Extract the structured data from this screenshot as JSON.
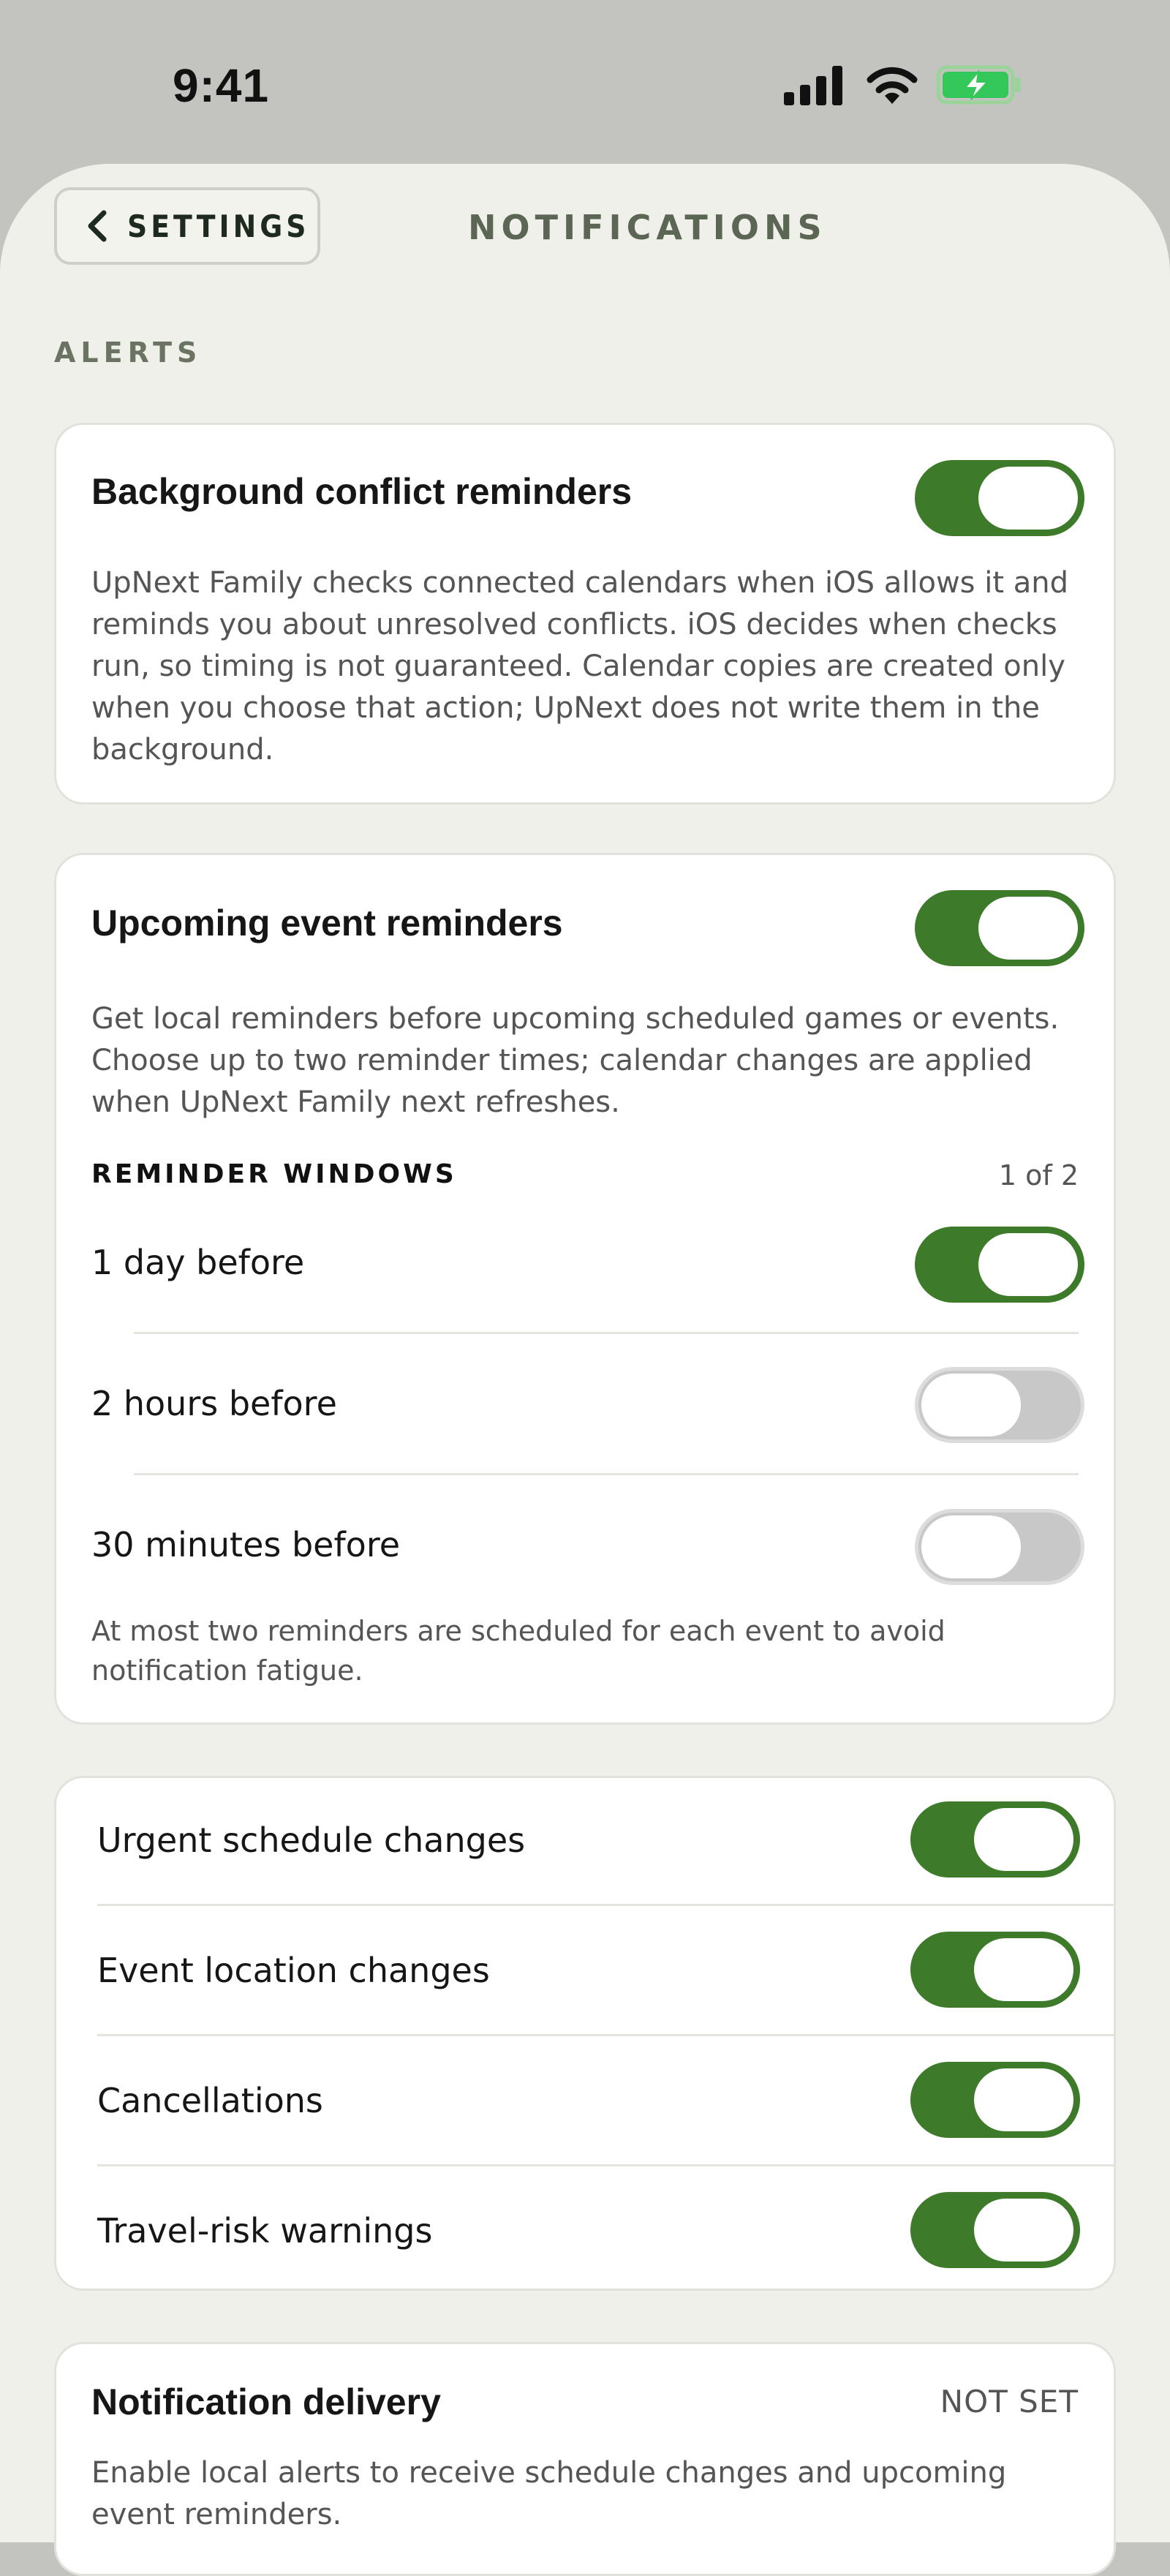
{
  "status_bar": {
    "time": "9:41",
    "icons": [
      "cellular-signal-icon",
      "wifi-icon",
      "battery-charging-icon"
    ],
    "battery_color": "#34c759"
  },
  "nav": {
    "back_label": "SETTINGS",
    "back_icon": "chevron-left-icon",
    "title": "NOTIFICATIONS"
  },
  "section": {
    "label": "ALERTS"
  },
  "background_conflict": {
    "title": "Background conflict reminders",
    "enabled": true,
    "description": "UpNext Family checks connected calendars when iOS allows it and reminds you about unresolved conflicts. iOS decides when checks run, so timing is not guaranteed. Calendar copies are created only when you choose that action; UpNext does not write them in the background."
  },
  "upcoming_events": {
    "title": "Upcoming event reminders",
    "enabled": true,
    "description": "Get local reminders before upcoming scheduled games or events. Choose up to two reminder times; calendar changes are applied when UpNext Family next refreshes.",
    "windows_header": "REMINDER WINDOWS",
    "windows_count": "1 of 2",
    "windows": [
      {
        "label": "1 day before",
        "enabled": true
      },
      {
        "label": "2 hours before",
        "enabled": false
      },
      {
        "label": "30 minutes before",
        "enabled": false
      }
    ],
    "note": "At most two reminders are scheduled for each event to avoid notification fatigue."
  },
  "change_alerts": [
    {
      "label": "Urgent schedule changes",
      "enabled": true
    },
    {
      "label": "Event location changes",
      "enabled": true
    },
    {
      "label": "Cancellations",
      "enabled": true
    },
    {
      "label": "Travel-risk warnings",
      "enabled": true
    }
  ],
  "delivery": {
    "title": "Notification delivery",
    "status": "NOT SET",
    "description": "Enable local alerts to receive schedule changes and upcoming event reminders."
  },
  "colors": {
    "accent": "#3d7a2a",
    "toggle_off": "#c8c8c8",
    "sheet_background": "#f0f0eb",
    "page_background": "#c3c3bf"
  }
}
